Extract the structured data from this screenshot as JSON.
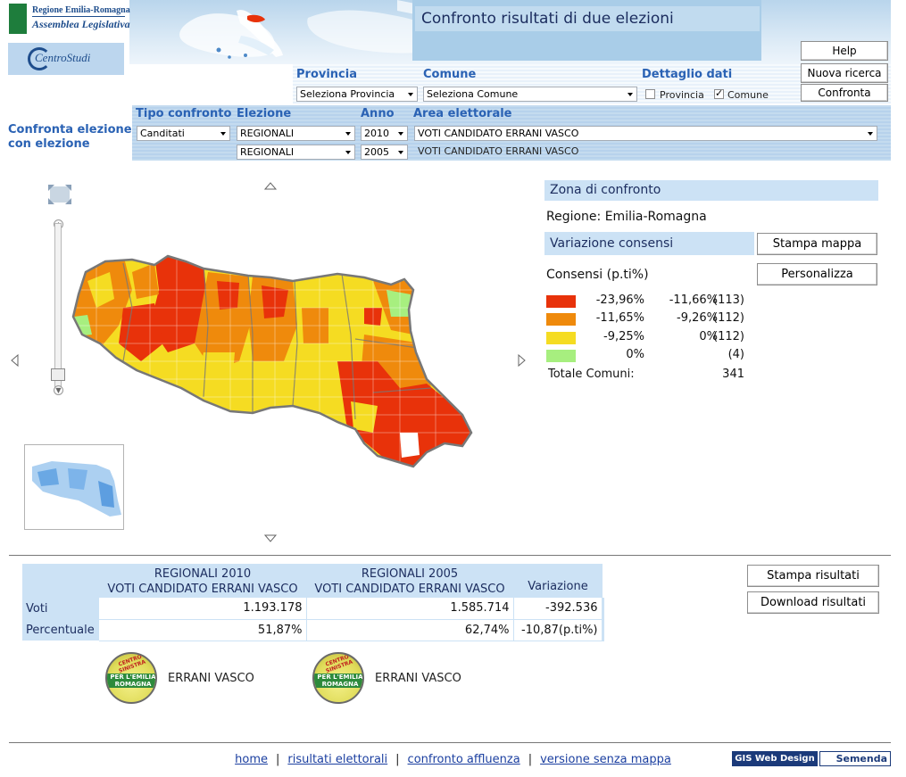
{
  "header": {
    "title": "Confronto risultati di due elezioni",
    "logo_region": {
      "line1": "Regione Emilia-Romagna",
      "line2": "Assemblea Legislativa"
    },
    "logo_centro": "CentroStudi",
    "buttons": {
      "help": "Help",
      "new_search": "Nuova ricerca",
      "compare": "Confronta"
    }
  },
  "filters": {
    "provincia": {
      "label": "Provincia",
      "value": "Seleziona Provincia"
    },
    "comune": {
      "label": "Comune",
      "value": "Seleziona Comune"
    },
    "dettaglio": {
      "label": "Dettaglio dati",
      "provincia_label": "Provincia",
      "provincia_checked": false,
      "comune_label": "Comune",
      "comune_checked": true
    }
  },
  "compare": {
    "section_label_1": "Confronta elezione",
    "section_label_2": "con elezione",
    "tipo_label": "Tipo confronto",
    "tipo_value": "Canditati",
    "elezione_label": "Elezione",
    "elezione_1": "REGIONALI",
    "elezione_2": "REGIONALI",
    "anno_label": "Anno",
    "anno_1": "2010",
    "anno_2": "2005",
    "area_label": "Area elettorale",
    "area_1": "VOTI CANDIDATO ERRANI VASCO",
    "area_2": "VOTI CANDIDATO ERRANI VASCO"
  },
  "map": {
    "legend_title": "Consensi (p.ti%)",
    "legend": [
      {
        "from": "-23,96%",
        "to": "-11,66%",
        "count": "(113)",
        "color": "#e8320a"
      },
      {
        "from": "-11,65%",
        "to": "-9,26%",
        "count": "(112)",
        "color": "#ef8a0c"
      },
      {
        "from": "-9,25%",
        "to": "0%",
        "count": "(112)",
        "color": "#f5dc22"
      },
      {
        "from": "0%",
        "to": "",
        "count": "(4)",
        "color": "#a7ef7f"
      }
    ],
    "totale_label": "Totale Comuni:",
    "totale_value": "341"
  },
  "side": {
    "zona_title": "Zona di confronto",
    "regione": "Regione: Emilia-Romagna",
    "variazione_title": "Variazione consensi",
    "stampa_mappa": "Stampa mappa",
    "personalizza": "Personalizza"
  },
  "results": {
    "col1_line1": "REGIONALI 2010",
    "col1_line2": "VOTI CANDIDATO ERRANI VASCO",
    "col2_line1": "REGIONALI 2005",
    "col2_line2": "VOTI CANDIDATO ERRANI VASCO",
    "col3": "Variazione",
    "rows": [
      {
        "label": "Voti",
        "v1": "1.193.178",
        "v2": "1.585.714",
        "v3": "-392.536"
      },
      {
        "label": "Percentuale",
        "v1": "51,87%",
        "v2": "62,74%",
        "v3": "-10,87(p.ti%)"
      }
    ],
    "stampa": "Stampa risultati",
    "download": "Download risultati",
    "candidates": [
      {
        "name": "ERRANI VASCO",
        "badge_top": "CENTRO SINISTRA",
        "badge_band": "PER L'EMILIA ROMAGNA"
      },
      {
        "name": "ERRANI VASCO",
        "badge_top": "CENTRO SINISTRA",
        "badge_band": "PER L'EMILIA ROMAGNA"
      }
    ]
  },
  "footer": {
    "links": [
      "home",
      "risultati elettorali",
      "confronto affluenza",
      "versione senza mappa"
    ],
    "separator": "|",
    "credit_1": "GIS Web Design",
    "credit_2": "Semenda"
  }
}
